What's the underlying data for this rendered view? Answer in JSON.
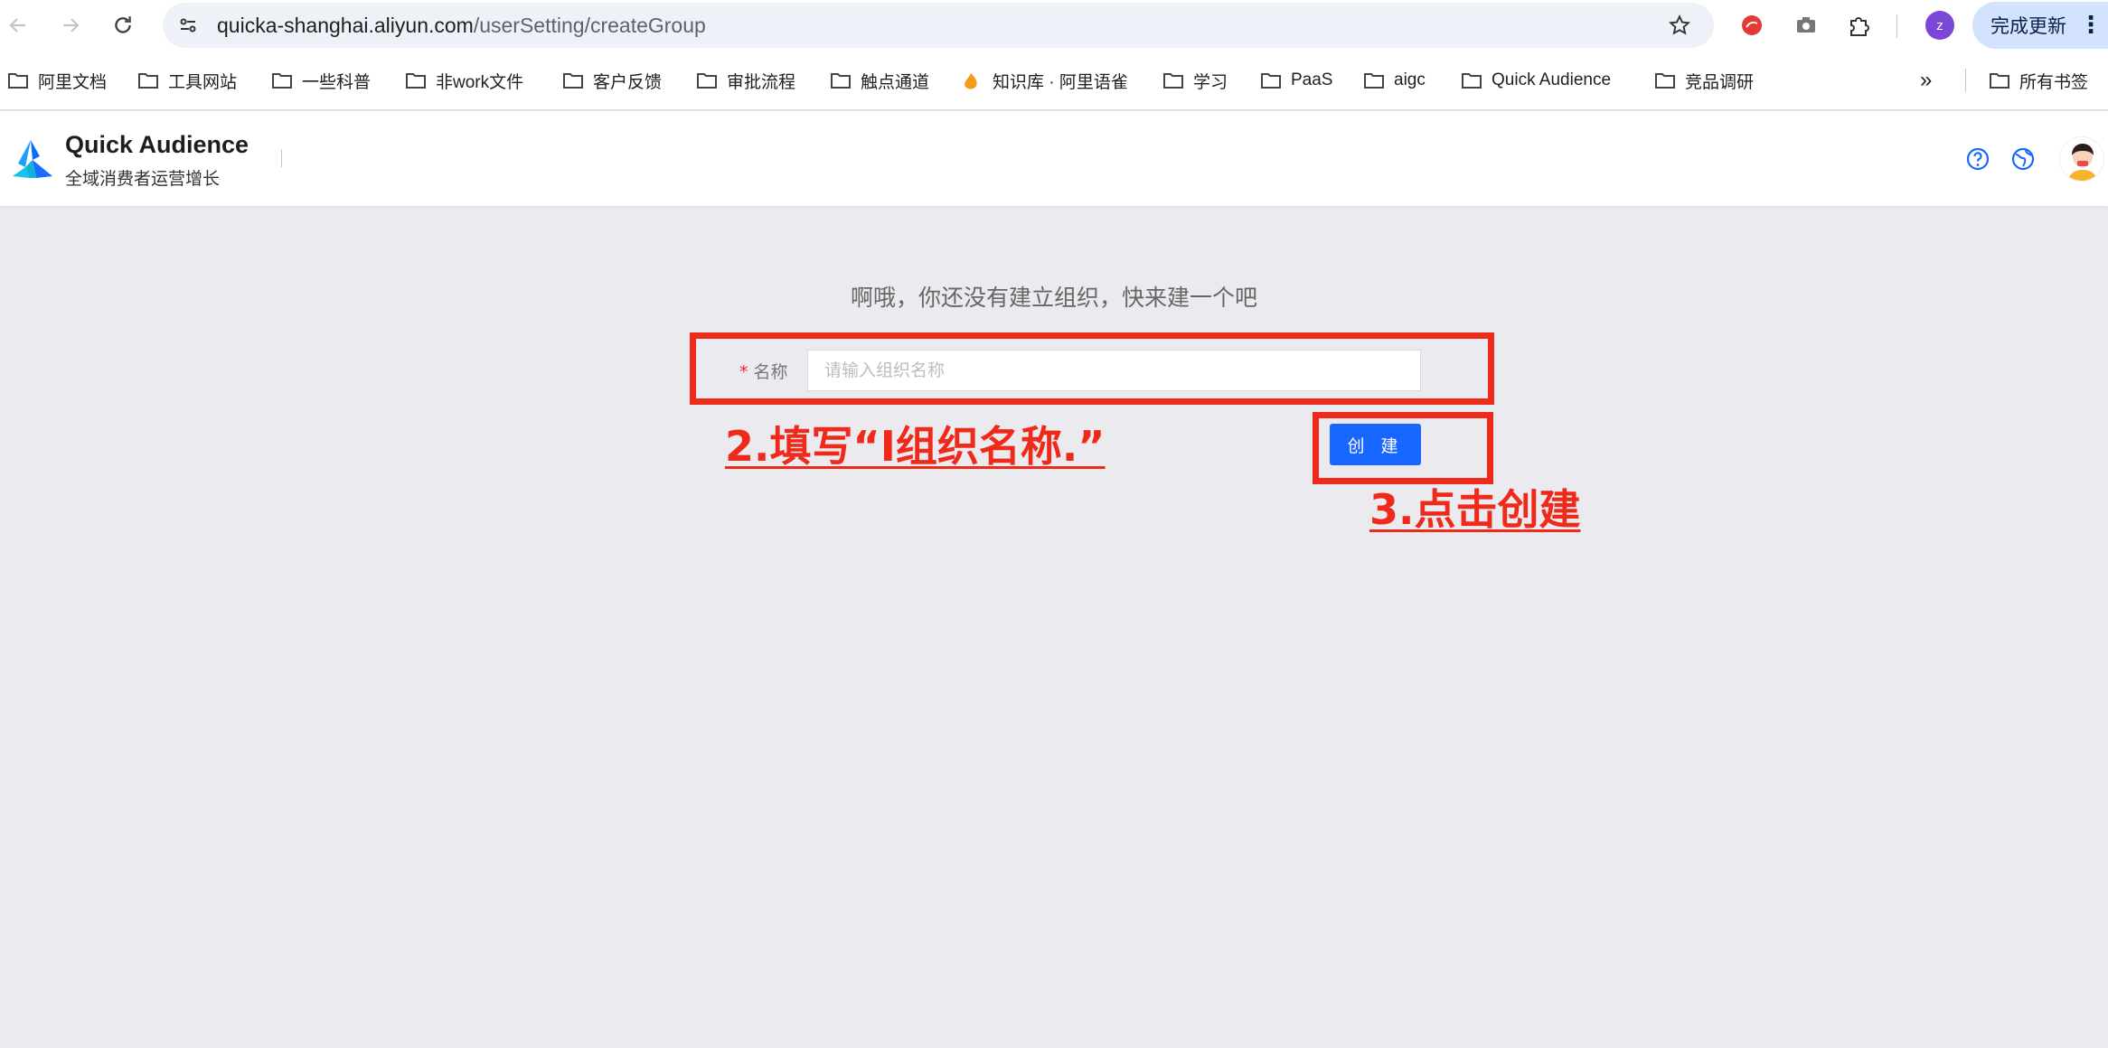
{
  "browser": {
    "url_host": "quicka-shanghai.aliyun.com",
    "url_path": "/userSetting/createGroup",
    "profile_initial": "z",
    "update_label": "完成更新",
    "menu_glyph": "⋮",
    "icons": [
      "back-icon",
      "forward-icon",
      "reload-icon",
      "site-settings-icon",
      "star-icon",
      "extension-red-icon",
      "camera-icon",
      "puzzle-icon"
    ]
  },
  "bookmarks": {
    "items": [
      {
        "label": "阿里文档",
        "icon": "folder-icon"
      },
      {
        "label": "工具网站",
        "icon": "folder-icon"
      },
      {
        "label": "一些科普",
        "icon": "folder-icon"
      },
      {
        "label": "非work文件",
        "icon": "folder-icon"
      },
      {
        "label": "客户反馈",
        "icon": "folder-icon"
      },
      {
        "label": "审批流程",
        "icon": "folder-icon"
      },
      {
        "label": "触点通道",
        "icon": "folder-icon"
      },
      {
        "label": "知识库 · 阿里语雀",
        "icon": "yuque-icon"
      },
      {
        "label": "学习",
        "icon": "folder-icon"
      },
      {
        "label": "PaaS",
        "icon": "folder-icon"
      },
      {
        "label": "aigc",
        "icon": "folder-icon"
      },
      {
        "label": "Quick Audience",
        "icon": "folder-icon"
      },
      {
        "label": "竞品调研",
        "icon": "folder-icon"
      }
    ],
    "overflow_glyph": "»",
    "all_bookmarks": "所有书签"
  },
  "app": {
    "brand_title": "Quick Audience",
    "brand_subtitle": "全域消费者运营增长",
    "accent": "#1767ff"
  },
  "main": {
    "hint": "啊哦，你还没有建立组织，快来建一个吧",
    "field_required": "*",
    "field_label": "名称",
    "field_placeholder": "请输入组织名称",
    "field_value": "",
    "create_label": "创 建"
  },
  "annotations": {
    "step2": "2.填写“I组织名称.”",
    "step3": "3.点击创建",
    "color": "#f02a1a"
  }
}
